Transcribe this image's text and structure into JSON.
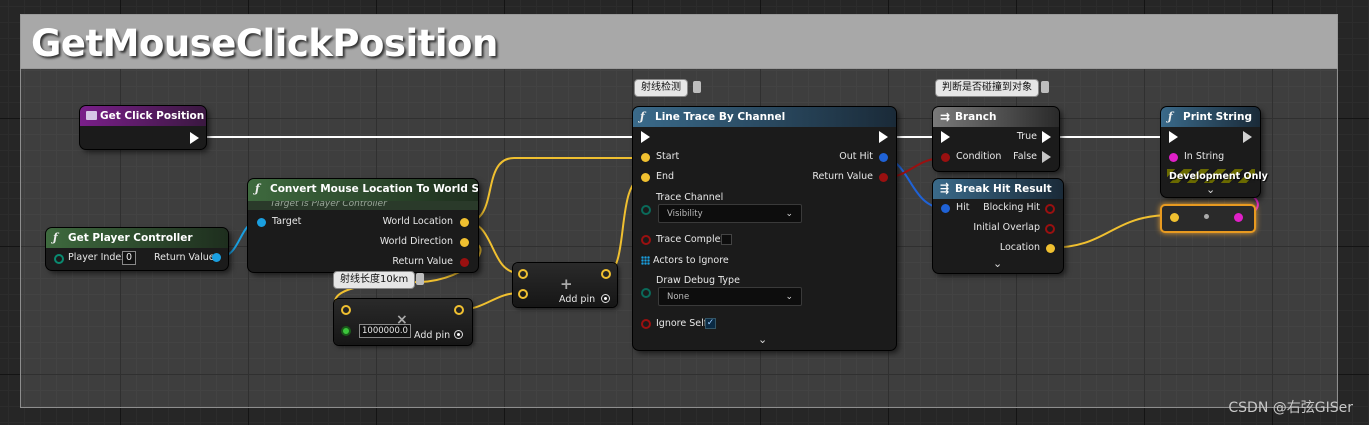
{
  "comment": {
    "title": "GetMouseClickPosition"
  },
  "nodes": {
    "get_click_position": {
      "title": "Get Click Position"
    },
    "get_player_controller": {
      "title": "Get Player Controller",
      "player_index_label": "Player Index",
      "player_index_value": "0",
      "return_value": "Return Value"
    },
    "convert_mouse": {
      "title": "Convert Mouse Location To World Space",
      "subtitle": "Target is Player Controller",
      "target": "Target",
      "world_location": "World Location",
      "world_direction": "World Direction",
      "return_value": "Return Value"
    },
    "multiply": {
      "tag": "射线长度10km",
      "value": "1000000.0",
      "add_pin": "Add pin"
    },
    "add": {
      "add_pin": "Add pin"
    },
    "line_trace": {
      "tag": "射线检测",
      "title": "Line Trace By Channel",
      "start": "Start",
      "end": "End",
      "trace_channel": "Trace Channel",
      "trace_channel_value": "Visibility",
      "trace_complex": "Trace Complex",
      "actors_to_ignore": "Actors to Ignore",
      "draw_debug_type": "Draw Debug Type",
      "draw_debug_value": "None",
      "ignore_self": "Ignore Self",
      "out_hit": "Out Hit",
      "return_value": "Return Value"
    },
    "branch": {
      "tag": "判断是否碰撞到对象",
      "title": "Branch",
      "condition": "Condition",
      "true_label": "True",
      "false_label": "False"
    },
    "break_hit": {
      "title": "Break Hit Result",
      "hit": "Hit",
      "blocking_hit": "Blocking Hit",
      "initial_overlap": "Initial Overlap",
      "location": "Location"
    },
    "print_string": {
      "title": "Print String",
      "in_string": "In String",
      "dev_only": "Development Only"
    }
  },
  "watermark": "CSDN @右弦GISer",
  "colors": {
    "exec": "#ffffff",
    "vector": "#f0c030",
    "float_green": "#3cc63c",
    "object": "#1a9fe0",
    "bool": "#9a1010",
    "struct_hit": "#1f62d6",
    "string": "#e020c8",
    "byte": "#0a6a5a"
  }
}
